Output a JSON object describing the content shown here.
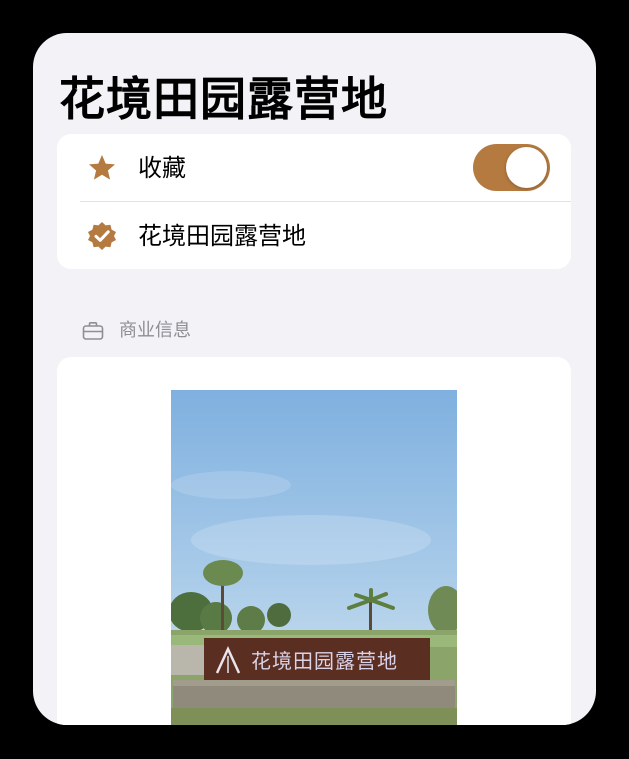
{
  "page": {
    "title": "花境田园露营地"
  },
  "favorites_card": {
    "favorite_label": "收藏",
    "favorite_icon": "star-icon",
    "favorite_toggle_on": true,
    "verified_label": "花境田园露营地",
    "verified_icon": "verified-badge-icon"
  },
  "business_section": {
    "icon": "briefcase-icon",
    "label": "商业信息"
  },
  "photo": {
    "sign_text": "花境田园露营地"
  },
  "colors": {
    "accent": "#b47a40",
    "background": "#f2f2f7",
    "card": "#ffffff",
    "secondary_text": "#8e8e93"
  }
}
